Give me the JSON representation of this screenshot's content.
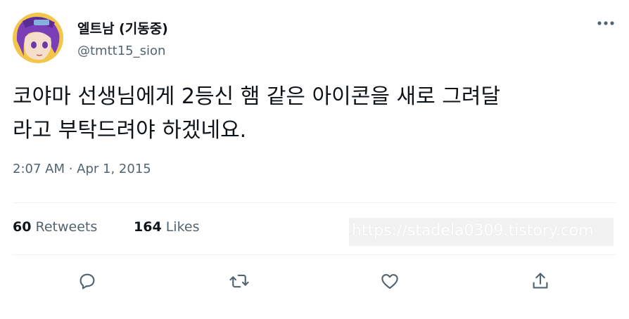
{
  "tweet": {
    "display_name": "엘트남 (기동중)",
    "handle": "@tmtt15_sion",
    "text_line1": "코야마 선생님에게 2등신 햄 같은 아이콘을 새로 그려달",
    "text_line2": "라고 부탁드려야 하겠네요.",
    "timestamp": "2:07 AM · Apr 1, 2015"
  },
  "stats": {
    "retweets_count": "60",
    "retweets_label": "Retweets",
    "likes_count": "164",
    "likes_label": "Likes"
  },
  "watermark": "https://stadela0309.tistory.com",
  "icons": {
    "more": "more-horizontal-icon",
    "reply": "reply-icon",
    "retweet": "retweet-icon",
    "like": "like-icon",
    "share": "share-icon"
  },
  "colors": {
    "text_primary": "#0f1419",
    "text_secondary": "#536471",
    "divider": "#eff3f4",
    "icon": "#536471"
  }
}
